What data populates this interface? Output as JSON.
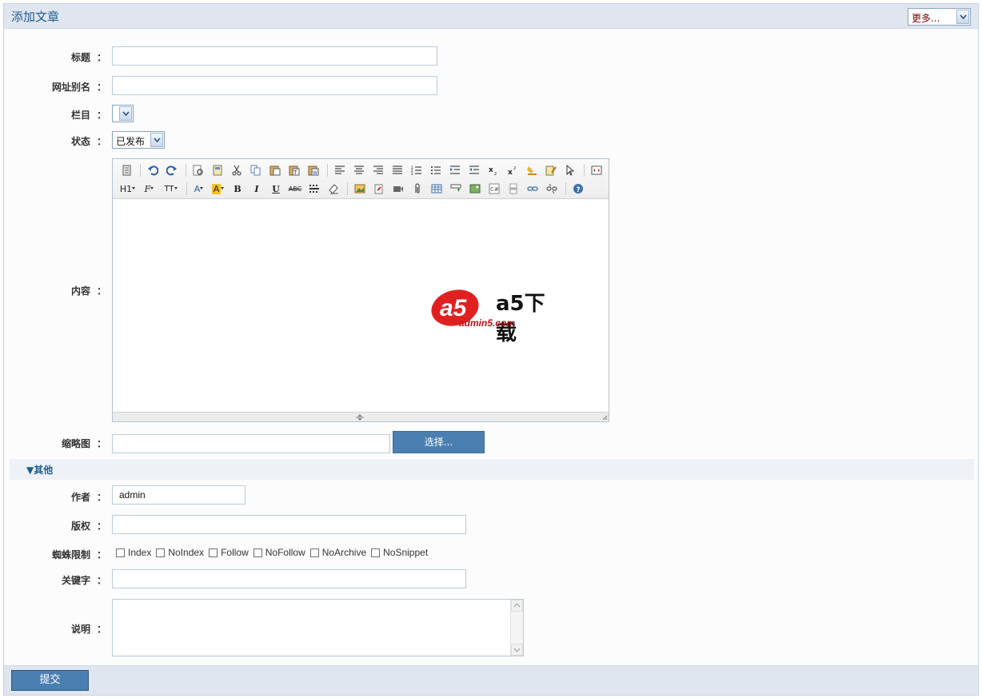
{
  "header": {
    "title": "添加文章",
    "more_select": "更多..."
  },
  "form": {
    "title_label": "标题",
    "slug_label": "网址别名",
    "category_label": "栏目",
    "category_value": "",
    "status_label": "状态",
    "status_value": "已发布",
    "content_label": "内容",
    "thumbnail_label": "缩略图",
    "choose_button": "选择...",
    "colon": "："
  },
  "editor": {
    "heading_btn": "H1",
    "font_btn": "F",
    "size_btn": "TT",
    "fontcolor_btn": "A",
    "highlight_btn": "A",
    "bold_btn": "B",
    "italic_btn": "I",
    "underline_btn": "U",
    "strike_btn": "ABC",
    "watermark_brand": "a5下载",
    "watermark_url": "admin5.com"
  },
  "other": {
    "section_title": "▼其他",
    "author_label": "作者",
    "author_value": "admin",
    "copyright_label": "版权",
    "spider_label": "蜘蛛限制",
    "spider_options": [
      "Index",
      "NoIndex",
      "Follow",
      "NoFollow",
      "NoArchive",
      "NoSnippet"
    ],
    "keywords_label": "关键字",
    "description_label": "说明"
  },
  "footer": {
    "submit": "提交"
  },
  "colors": {
    "accent": "#4b7fb2",
    "header_bg": "#dfe6f0",
    "title": "#1f5c8d"
  }
}
